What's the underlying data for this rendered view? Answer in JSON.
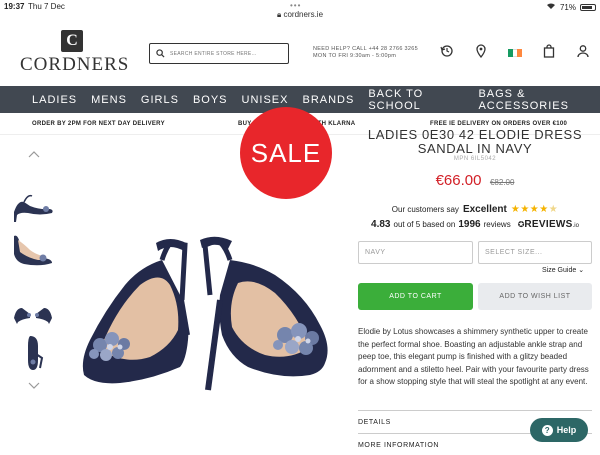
{
  "statusbar": {
    "time": "19:37",
    "date": "Thu 7 Dec",
    "url": "cordners.ie",
    "battery": "71%"
  },
  "header": {
    "logo": "CORDNERS",
    "search_placeholder": "SEARCH ENTIRE STORE HERE...",
    "help_line1": "NEED HELP? CALL +44 28 2766 3265",
    "help_line2": "MON TO FRI  9:30am - 5:00pm"
  },
  "nav": [
    "LADIES",
    "MENS",
    "GIRLS",
    "BOYS",
    "UNISEX",
    "BRANDS",
    "BACK TO SCHOOL",
    "BAGS & ACCESSORIES"
  ],
  "promo": {
    "left": "ORDER BY 2PM FOR NEXT DAY DELIVERY",
    "center": "BUY NOW, PAY LATER WITH KLARNA",
    "right": "FREE IE DELIVERY ON ORDERS OVER €100"
  },
  "sale_badge": "SALE",
  "product": {
    "title_line1": "LADIES 0E30 42 ELODIE DRESS",
    "title_line2": "SANDAL IN NAVY",
    "mpn": "MPN 6IL5042",
    "price": "€66.00",
    "old_price": "€82.00",
    "reviews_prefix": "Our customers say",
    "reviews_rating_word": "Excellent",
    "reviews_stars": 4.5,
    "reviews_score": "4.83",
    "reviews_mid": "out of 5 based on",
    "reviews_count": "1996",
    "reviews_suffix": "reviews",
    "reviews_brand": "REVIEWS",
    "reviews_brand_suffix": ".io",
    "colour_value": "NAVY",
    "size_placeholder": "SELECT SIZE...",
    "size_guide": "Size Guide",
    "add_to_cart": "ADD TO CART",
    "add_to_wishlist": "ADD TO WISH LIST",
    "description": "Elodie by Lotus showcases a shimmery synthetic upper to create the perfect formal shoe. Boasting an adjustable ankle strap and peep toe, this elegant pump is finished with a glitzy beaded adornment and a stiletto heel. Pair with your favourite party dress for a show stopping style that will steal the spotlight at any event.",
    "details_label": "DETAILS",
    "more_info_label": "MORE INFORMATION"
  },
  "help_button": "Help",
  "colors": {
    "nav_bg": "#414851",
    "sale_red": "#e8262b",
    "price_red": "#d21f26",
    "cart_green": "#3bae3a",
    "help_teal": "#2d6766"
  }
}
